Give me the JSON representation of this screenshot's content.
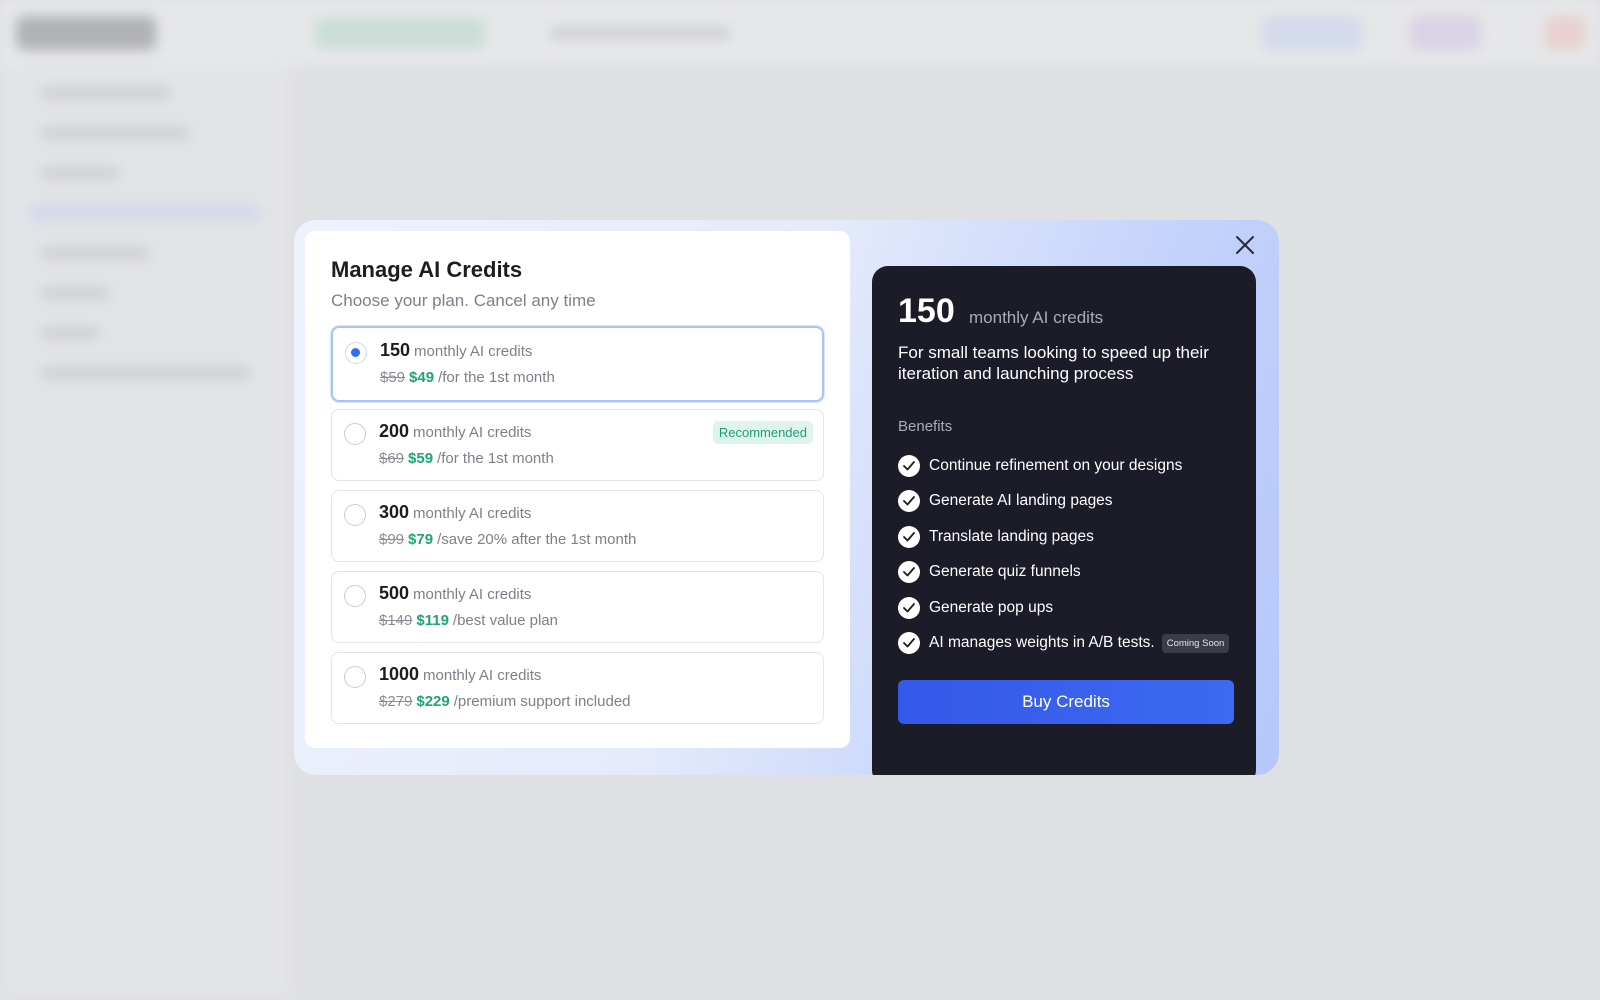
{
  "modal": {
    "title": "Manage AI Credits",
    "subtitle": "Choose your plan. Cancel any time",
    "plans": [
      {
        "credits": "150",
        "unit": "monthly AI credits",
        "old_price": "$59",
        "new_price": "$49",
        "note": "/for the 1st month",
        "selected": true
      },
      {
        "credits": "200",
        "unit": "monthly AI credits",
        "old_price": "$69",
        "new_price": "$59",
        "note": "/for the 1st month",
        "badge": "Recommended"
      },
      {
        "credits": "300",
        "unit": "monthly AI credits",
        "old_price": "$99",
        "new_price": "$79",
        "note": "/save 20% after the 1st month"
      },
      {
        "credits": "500",
        "unit": "monthly AI credits",
        "old_price": "$149",
        "new_price": "$119",
        "note": "/best value plan"
      },
      {
        "credits": "1000",
        "unit": "monthly AI credits",
        "old_price": "$279",
        "new_price": "$229",
        "note": "/premium support included"
      }
    ],
    "close_icon": "close-icon"
  },
  "summary": {
    "credits": "150",
    "unit": "monthly AI credits",
    "description": "For small teams looking to speed up their iteration and launching process",
    "benefits_heading": "Benefits",
    "benefits": [
      {
        "text": "Continue refinement on your designs"
      },
      {
        "text": "Generate AI landing pages"
      },
      {
        "text": "Translate landing pages"
      },
      {
        "text": "Generate quiz funnels"
      },
      {
        "text": "Generate pop ups"
      },
      {
        "text": "AI manages weights in A/B tests.",
        "tag": "Coming Soon"
      }
    ],
    "buy_label": "Buy Credits"
  },
  "colors": {
    "accent": "#2f6ff0",
    "price_green": "#1ea672",
    "dark_card": "#1b1c27",
    "button_blue": "#3458e8"
  }
}
